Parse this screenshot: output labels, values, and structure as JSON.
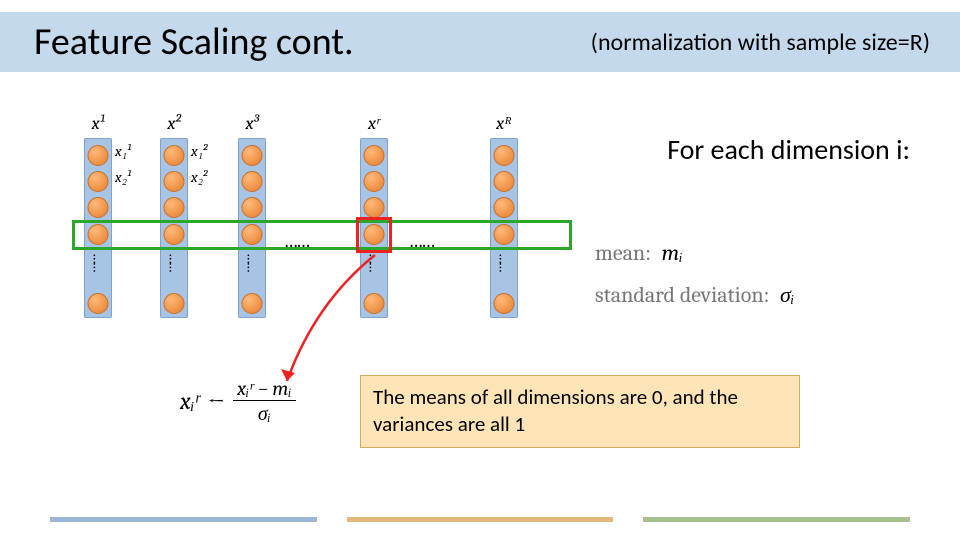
{
  "title": "Feature Scaling cont.",
  "subtitle": "(normalization with sample size=R)",
  "for_each": "For each dimension i:",
  "mean_label": "mean:",
  "mean_symbol": "mᵢ",
  "std_label": "standard deviation:",
  "std_symbol": "σᵢ",
  "col_labels": [
    "x¹",
    "x²",
    "x³",
    "xʳ",
    "xᴿ"
  ],
  "sub_labels": {
    "c0b0": "x₁¹",
    "c0b1": "x₂¹",
    "c1b0": "x₁²",
    "c1b1": "x₂²"
  },
  "hdots": "……",
  "formula": {
    "lhs": "xᵢʳ",
    "arrow": "←",
    "num": "xᵢʳ − mᵢ",
    "den": "σᵢ"
  },
  "result_text": "The means of all dimensions are 0, and the variances are all 1"
}
